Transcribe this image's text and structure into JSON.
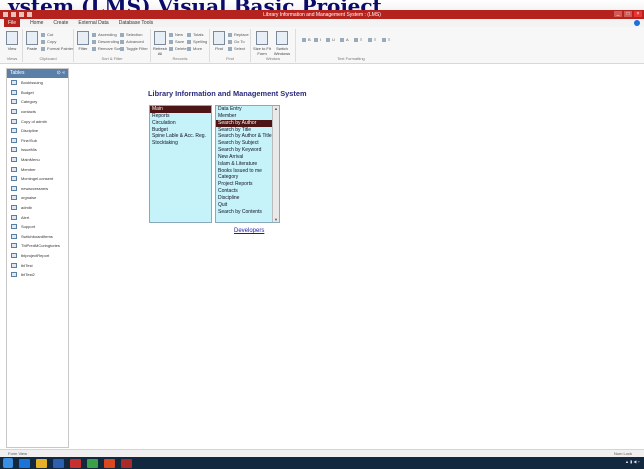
{
  "banner": {
    "text": "ystem (LMS) Visual Basic Project"
  },
  "titlebar": {
    "title": "Library Information and Management System : (LMS)"
  },
  "ribbon_tabs": [
    "File",
    "Home",
    "Create",
    "External Data",
    "Database Tools"
  ],
  "ribbon": {
    "groups": [
      {
        "label": "Views",
        "buttons": [
          "View"
        ]
      },
      {
        "label": "Clipboard",
        "buttons": [
          "Paste"
        ],
        "small": [
          "Cut",
          "Copy",
          "Format Painter"
        ]
      },
      {
        "label": "Sort & Filter",
        "buttons": [
          "Filter"
        ],
        "small": [
          "Ascending",
          "Descending",
          "Remove Sort",
          "Selection",
          "Advanced",
          "Toggle Filter"
        ]
      },
      {
        "label": "Records",
        "buttons": [
          "Refresh All"
        ],
        "small": [
          "New",
          "Save",
          "Delete",
          "Totals",
          "Spelling",
          "More"
        ]
      },
      {
        "label": "Find",
        "buttons": [
          "Find"
        ],
        "small": [
          "Replace",
          "Go To",
          "Select"
        ]
      },
      {
        "label": "Window",
        "buttons": [
          "Size to Fit Form",
          "Switch Windows"
        ]
      },
      {
        "label": "Text Formatting",
        "buttons": []
      }
    ]
  },
  "nav": {
    "header": "Tables",
    "items": [
      "BookIssuing",
      "Budget",
      "Category",
      "contacts",
      "Copy of admib",
      "Discipline",
      "Fine/Sub",
      "IssueMis",
      "MainMenu",
      "Member",
      "Mcmingel.consent",
      "newaccessnew",
      "orgnaise",
      "admib",
      "Alert",
      "Support",
      "SwitchboardItems",
      "TblPredMCoringtories",
      "tblprojectReport",
      "tblTest",
      "tblTest2"
    ]
  },
  "form": {
    "title": "Library Information and Management System",
    "list1": [
      "Main",
      "Reports",
      "Circulation",
      "Budget",
      "Spine Lable & Acc. Reg.",
      "Stocktaking"
    ],
    "list1_selected": 0,
    "list2": [
      "Data Entry",
      "Member",
      "Search by Author",
      "Search by Title",
      "Search by Author & Title",
      "Search by Subject",
      "Search by Keyword",
      "New Arrival",
      "Islam & Literature",
      "Books Issued to me",
      "Category",
      "Project Reports",
      "Contacts",
      "Discipline",
      "Quit",
      "Search by Contents"
    ],
    "list2_selected": 2,
    "developers_link": "Developers"
  },
  "status": {
    "left": "Form View",
    "right": "Num Lock"
  },
  "colors": {
    "accent": "#b5231f",
    "list_bg": "#c6f2f9",
    "selection": "#4d1515",
    "taskbar": "#12283f"
  }
}
